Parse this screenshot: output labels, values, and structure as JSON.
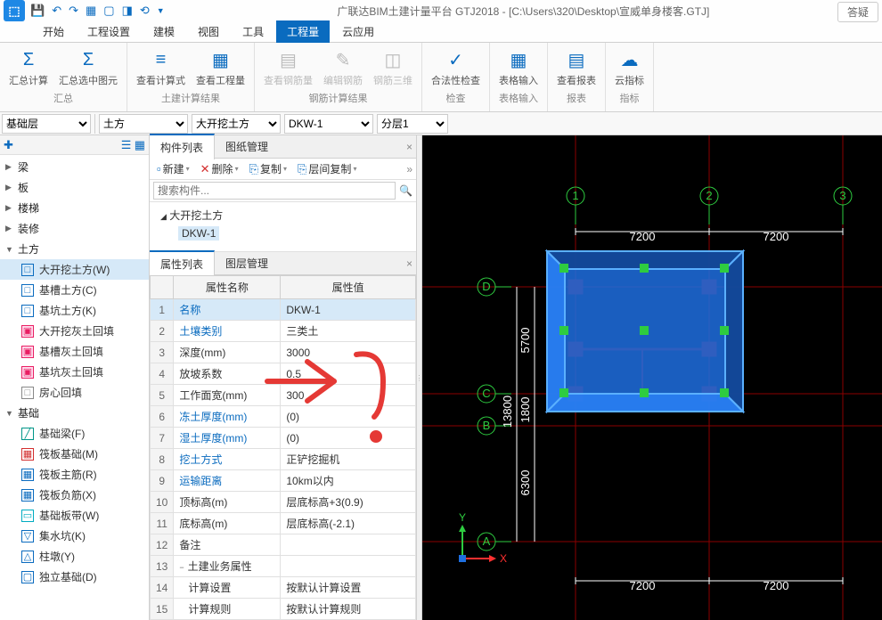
{
  "window": {
    "title": "广联达BIM土建计量平台 GTJ2018 - [C:\\Users\\320\\Desktop\\宣威单身楼客.GTJ]",
    "answer": "答疑"
  },
  "tabs": [
    "开始",
    "工程设置",
    "建模",
    "视图",
    "工具",
    "工程量",
    "云应用"
  ],
  "active_tab": 5,
  "ribbon": {
    "groups": [
      {
        "name": "汇总",
        "buttons": [
          {
            "label": "汇总计算",
            "icon": "Σ"
          },
          {
            "label": "汇总选中图元",
            "icon": "Σ"
          }
        ]
      },
      {
        "name": "土建计算结果",
        "buttons": [
          {
            "label": "查看计算式",
            "icon": "≡"
          },
          {
            "label": "查看工程量",
            "icon": "▦"
          }
        ]
      },
      {
        "name": "钢筋计算结果",
        "buttons": [
          {
            "label": "查看钢筋量",
            "icon": "▤",
            "disabled": true
          },
          {
            "label": "编辑钢筋",
            "icon": "✎",
            "disabled": true
          },
          {
            "label": "钢筋三维",
            "icon": "◫",
            "disabled": true
          }
        ]
      },
      {
        "name": "检查",
        "buttons": [
          {
            "label": "合法性检查",
            "icon": "✓"
          }
        ]
      },
      {
        "name": "表格输入",
        "buttons": [
          {
            "label": "表格输入",
            "icon": "▦"
          }
        ]
      },
      {
        "name": "报表",
        "buttons": [
          {
            "label": "查看报表",
            "icon": "▤"
          }
        ]
      },
      {
        "name": "指标",
        "buttons": [
          {
            "label": "云指标",
            "icon": "☁"
          }
        ]
      }
    ]
  },
  "selectors": {
    "floor": "基础层",
    "cat": "土方",
    "sub": "大开挖土方",
    "comp": "DKW-1",
    "layer": "分层1"
  },
  "tree": {
    "cats": [
      {
        "label": "梁",
        "exp": "▶"
      },
      {
        "label": "板",
        "exp": "▶"
      },
      {
        "label": "楼梯",
        "exp": "▶"
      },
      {
        "label": "装修",
        "exp": "▶"
      },
      {
        "label": "土方",
        "exp": "▼",
        "items": [
          {
            "label": "大开挖土方(W)",
            "icon": "□",
            "cls": "blue",
            "sel": true
          },
          {
            "label": "基槽土方(C)",
            "icon": "□",
            "cls": "blue"
          },
          {
            "label": "基坑土方(K)",
            "icon": "□",
            "cls": "blue"
          },
          {
            "label": "大开挖灰土回填",
            "icon": "▣",
            "cls": "pink"
          },
          {
            "label": "基槽灰土回填",
            "icon": "▣",
            "cls": "pink"
          },
          {
            "label": "基坑灰土回填",
            "icon": "▣",
            "cls": "pink"
          },
          {
            "label": "房心回填",
            "icon": "□",
            "cls": "gray"
          }
        ]
      },
      {
        "label": "基础",
        "exp": "▼",
        "items": [
          {
            "label": "基础梁(F)",
            "icon": "╱",
            "cls": "teal"
          },
          {
            "label": "筏板基础(M)",
            "icon": "▦",
            "cls": "red"
          },
          {
            "label": "筏板主筋(R)",
            "icon": "▦",
            "cls": "blue"
          },
          {
            "label": "筏板负筋(X)",
            "icon": "▦",
            "cls": "blue"
          },
          {
            "label": "基础板带(W)",
            "icon": "▭",
            "cls": "cyan"
          },
          {
            "label": "集水坑(K)",
            "icon": "▽",
            "cls": "blue"
          },
          {
            "label": "柱墩(Y)",
            "icon": "△",
            "cls": "blue"
          },
          {
            "label": "独立基础(D)",
            "icon": "▢",
            "cls": "blue"
          }
        ]
      }
    ]
  },
  "comp_panel": {
    "tabs": [
      "构件列表",
      "图纸管理"
    ],
    "tools": [
      {
        "label": "新建",
        "icon": "▫"
      },
      {
        "label": "删除",
        "icon": "✕",
        "red": true
      },
      {
        "label": "复制",
        "icon": "⎘"
      },
      {
        "label": "层间复制",
        "icon": "⎘"
      }
    ],
    "search_placeholder": "搜索构件...",
    "tree": {
      "parent": "大开挖土方",
      "child": "DKW-1"
    }
  },
  "prop_panel": {
    "tabs": [
      "属性列表",
      "图层管理"
    ],
    "headers": [
      "属性名称",
      "属性值"
    ],
    "rows": [
      {
        "n": "1",
        "name": "名称",
        "val": "DKW-1",
        "link": true,
        "sel": true
      },
      {
        "n": "2",
        "name": "土壤类别",
        "val": "三类土",
        "link": true
      },
      {
        "n": "3",
        "name": "深度(mm)",
        "val": "3000"
      },
      {
        "n": "4",
        "name": "放坡系数",
        "val": "0.5"
      },
      {
        "n": "5",
        "name": "工作面宽(mm)",
        "val": "300"
      },
      {
        "n": "6",
        "name": "冻土厚度(mm)",
        "val": "(0)",
        "link": true
      },
      {
        "n": "7",
        "name": "湿土厚度(mm)",
        "val": "(0)",
        "link": true
      },
      {
        "n": "8",
        "name": "挖土方式",
        "val": "正铲挖掘机",
        "link": true
      },
      {
        "n": "9",
        "name": "运输距离",
        "val": "10km以内",
        "link": true
      },
      {
        "n": "10",
        "name": "顶标高(m)",
        "val": "层底标高+3(0.9)"
      },
      {
        "n": "11",
        "name": "底标高(m)",
        "val": "层底标高(-2.1)"
      },
      {
        "n": "12",
        "name": "备注",
        "val": ""
      },
      {
        "n": "13",
        "name": "土建业务属性",
        "val": "",
        "group": true
      },
      {
        "n": "14",
        "name": "计算设置",
        "val": "按默认计算设置",
        "indent": true
      },
      {
        "n": "15",
        "name": "计算规则",
        "val": "按默认计算规则",
        "indent": true
      }
    ]
  },
  "canvas": {
    "axes": {
      "x": "X",
      "y": "Y"
    },
    "grids": {
      "top": [
        "1",
        "2",
        "3"
      ],
      "left": [
        "D",
        "C",
        "B",
        "A"
      ]
    },
    "dims": {
      "t1": "7200",
      "t2": "7200",
      "b1": "7200",
      "b2": "7200",
      "l1": "5700",
      "l2": "1800",
      "l3": "6300",
      "ltot": "13800"
    }
  }
}
